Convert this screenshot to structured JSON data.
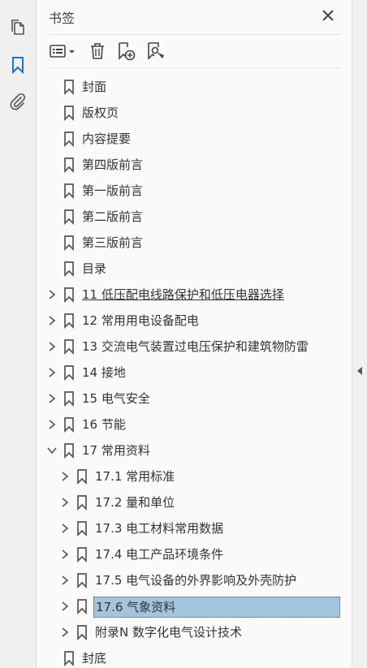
{
  "panel": {
    "title": "书签"
  },
  "colors": {
    "selection": "#a3c4dd",
    "icon": "#555555"
  },
  "bookmarks": [
    {
      "label": "封面",
      "level": 0,
      "expandable": false
    },
    {
      "label": "版权页",
      "level": 0,
      "expandable": false
    },
    {
      "label": "内容提要",
      "level": 0,
      "expandable": false
    },
    {
      "label": "第四版前言",
      "level": 0,
      "expandable": false
    },
    {
      "label": "第一版前言",
      "level": 0,
      "expandable": false
    },
    {
      "label": "第二版前言",
      "level": 0,
      "expandable": false
    },
    {
      "label": "第三版前言",
      "level": 0,
      "expandable": false
    },
    {
      "label": "目录",
      "level": 0,
      "expandable": false
    },
    {
      "label": "11 低压配电线路保护和低压电器选择",
      "level": 0,
      "expandable": true,
      "expanded": false,
      "underlined": true
    },
    {
      "label": "12 常用用电设备配电",
      "level": 0,
      "expandable": true,
      "expanded": false
    },
    {
      "label": "13 交流电气装置过电压保护和建筑物防雷",
      "level": 0,
      "expandable": true,
      "expanded": false
    },
    {
      "label": "14 接地",
      "level": 0,
      "expandable": true,
      "expanded": false
    },
    {
      "label": "15 电气安全",
      "level": 0,
      "expandable": true,
      "expanded": false
    },
    {
      "label": "16 节能",
      "level": 0,
      "expandable": true,
      "expanded": false
    },
    {
      "label": "17 常用资料",
      "level": 0,
      "expandable": true,
      "expanded": true
    },
    {
      "label": "17.1 常用标准",
      "level": 1,
      "expandable": true,
      "expanded": false
    },
    {
      "label": "17.2 量和单位",
      "level": 1,
      "expandable": true,
      "expanded": false
    },
    {
      "label": "17.3 电工材料常用数据",
      "level": 1,
      "expandable": true,
      "expanded": false
    },
    {
      "label": "17.4 电工产品环境条件",
      "level": 1,
      "expandable": true,
      "expanded": false
    },
    {
      "label": "17.5 电气设备的外界影响及外壳防护",
      "level": 1,
      "expandable": true,
      "expanded": false
    },
    {
      "label": "17.6 气象资料",
      "level": 1,
      "expandable": true,
      "expanded": false,
      "selected": true
    },
    {
      "label": "附录N 数字化电气设计技术",
      "level": 1,
      "expandable": true,
      "expanded": false
    },
    {
      "label": "封底",
      "level": 0,
      "expandable": false
    }
  ]
}
